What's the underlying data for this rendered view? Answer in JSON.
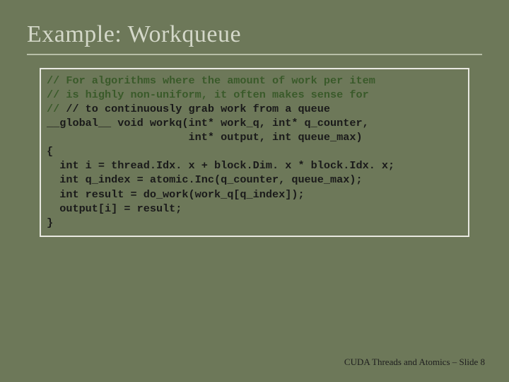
{
  "title": "Example: Workqueue",
  "code": {
    "l1": "// For algorithms where the amount of work per item",
    "l2": "// is highly non-uniform, it often makes sense for",
    "l3": "// to continuously grab work from a queue",
    "l4": "__global__ void workq(int* work_q, int* q_counter,",
    "l5": "                      int* output, int queue_max)",
    "l6": "{",
    "l7": "  int i = thread.Idx. x + block.Dim. x * block.Idx. x;",
    "l8": "  int q_index = atomic.Inc(q_counter, queue_max);",
    "l9": "  int result = do_work(work_q[q_index]);",
    "l10": "  output[i] = result;",
    "l11": "}"
  },
  "commentPrefix": "// ",
  "footer": "CUDA Threads and Atomics – Slide  8"
}
